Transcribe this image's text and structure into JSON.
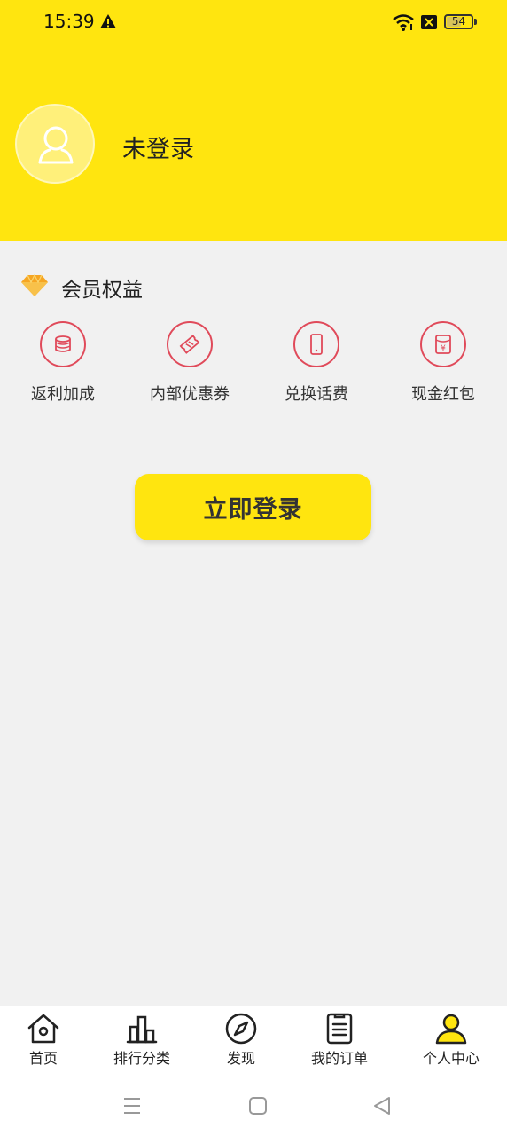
{
  "status_bar": {
    "time": "15:39",
    "battery": "54"
  },
  "profile": {
    "username": "未登录"
  },
  "benefits": {
    "title": "会员权益",
    "items": [
      {
        "label": "返利加成",
        "icon": "coin-stack-icon"
      },
      {
        "label": "内部优惠券",
        "icon": "ticket-icon"
      },
      {
        "label": "兑换话费",
        "icon": "phone-icon"
      },
      {
        "label": "现金红包",
        "icon": "red-envelope-icon"
      }
    ]
  },
  "login_button": {
    "label": "立即登录"
  },
  "tabs": [
    {
      "label": "首页",
      "icon": "home-icon"
    },
    {
      "label": "排行分类",
      "icon": "ranking-icon"
    },
    {
      "label": "发现",
      "icon": "compass-icon"
    },
    {
      "label": "我的订单",
      "icon": "order-list-icon"
    },
    {
      "label": "个人中心",
      "icon": "user-icon",
      "active": true
    }
  ],
  "colors": {
    "brand_yellow": "#ffe50f",
    "accent_red": "#e04a5a",
    "background": "#f1f1f1"
  }
}
